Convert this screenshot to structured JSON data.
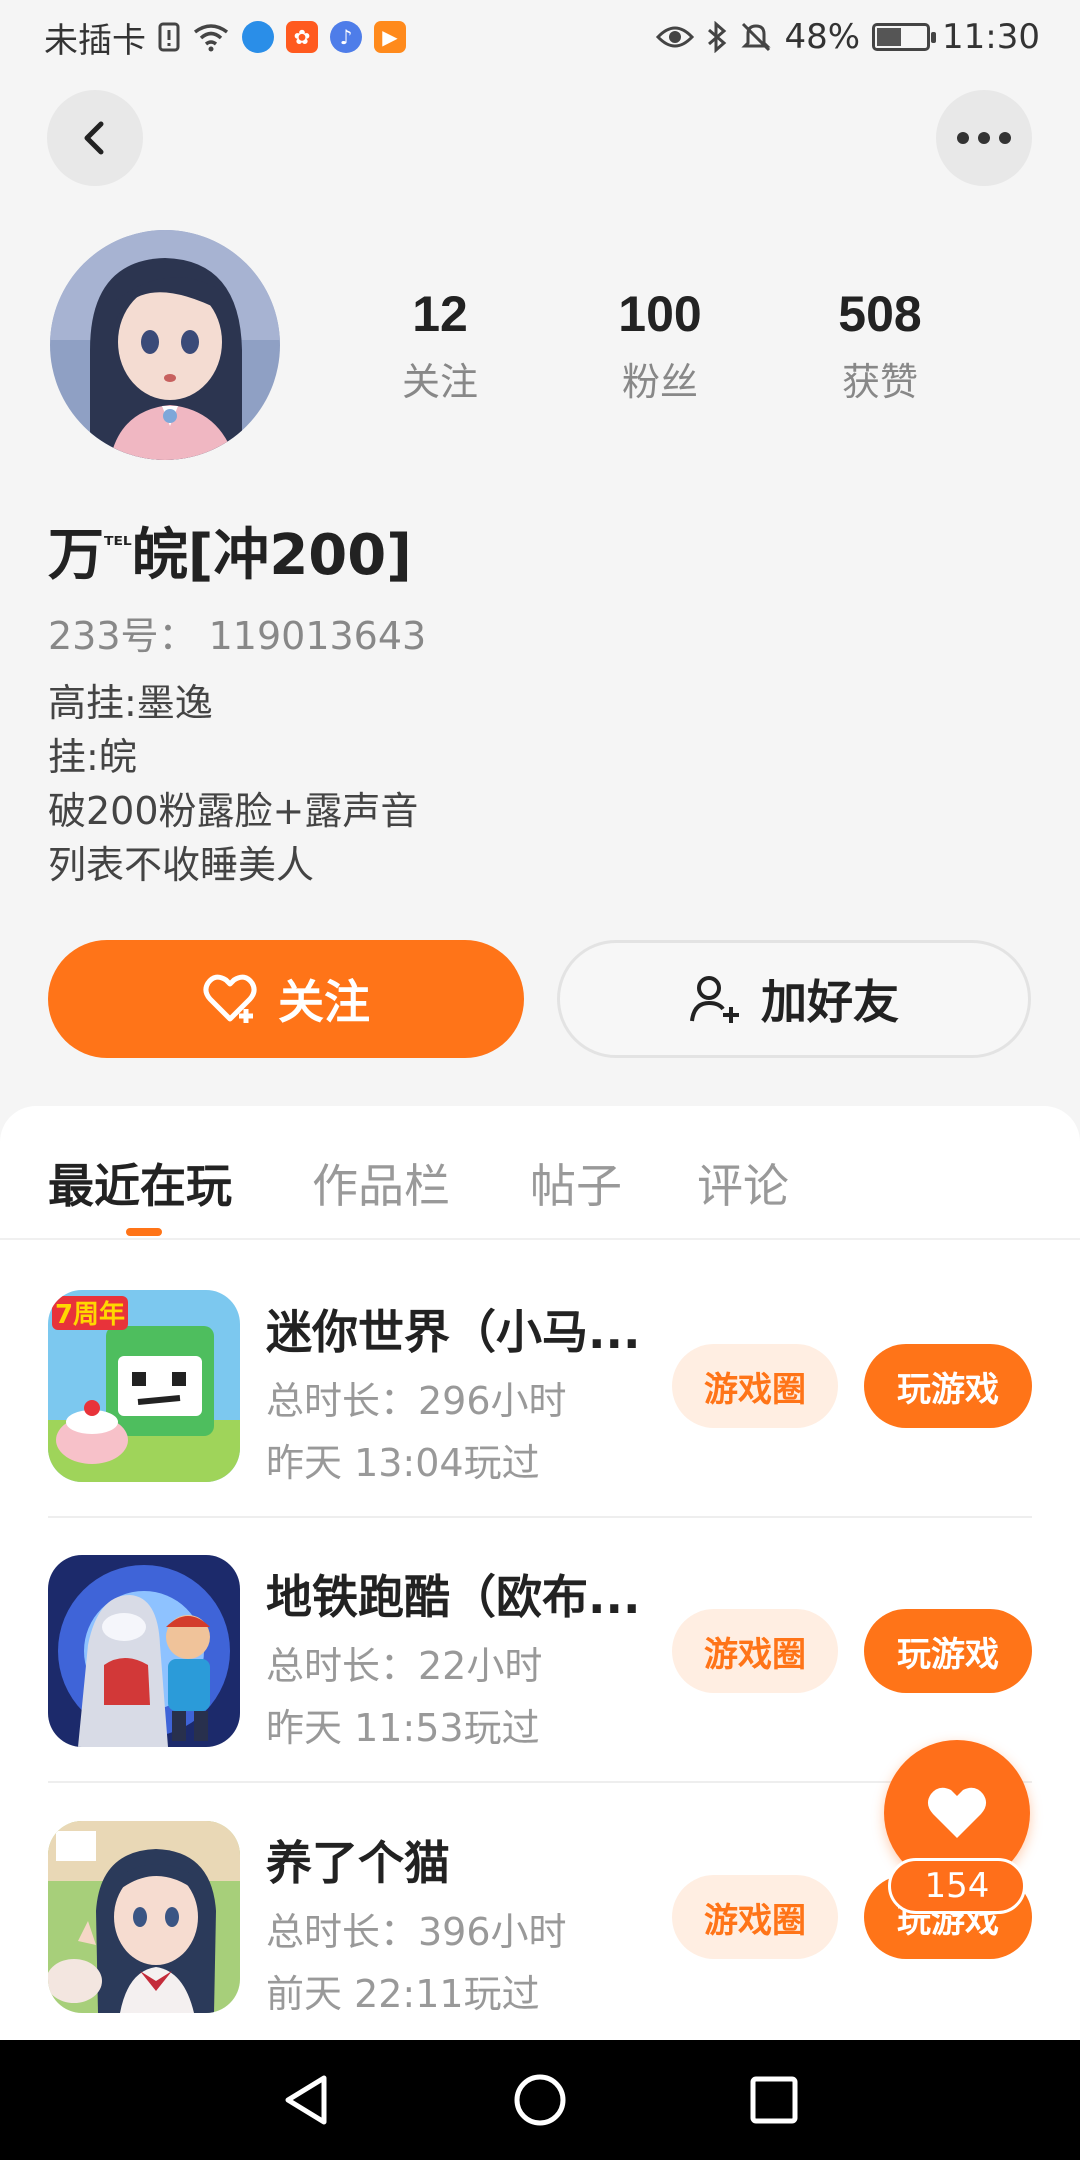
{
  "status_bar": {
    "carrier": "未插卡",
    "battery_percent": "48%",
    "battery_level": 0.48,
    "time": "11:30",
    "icons": [
      "sim-alert-icon",
      "wifi-icon",
      "browser-icon",
      "app-icon",
      "music-icon",
      "video-icon",
      "eye-icon",
      "bluetooth-icon",
      "mute-icon",
      "battery-icon"
    ]
  },
  "nav": {
    "back_icon": "chevron-left-icon",
    "more_icon": "more-dots-icon"
  },
  "profile": {
    "stats": [
      {
        "value": "12",
        "label": "关注"
      },
      {
        "value": "100",
        "label": "粉丝"
      },
      {
        "value": "508",
        "label": "获赞"
      }
    ],
    "nickname_main": "万",
    "nickname_sup": "ᵀᴱᴸ",
    "nickname_rest": "皖[冲200]",
    "id_text": "233号： 119013643",
    "bio_lines": [
      "高挂:墨逸",
      "挂:皖",
      "破200粉露脸+露声音",
      "列表不收睡美人"
    ]
  },
  "actions": {
    "follow_label": "关注",
    "add_friend_label": "加好友",
    "accent": "#ff7418"
  },
  "tabs": [
    {
      "label": "最近在玩",
      "active": true
    },
    {
      "label": "作品栏",
      "active": false
    },
    {
      "label": "帖子",
      "active": false
    },
    {
      "label": "评论",
      "active": false
    }
  ],
  "games": [
    {
      "name": "迷你世界（小马...",
      "total": "总时长：296小时",
      "last": "昨天 13:04玩过",
      "circle_label": "游戏圈",
      "play_label": "玩游戏",
      "badge": "7周年"
    },
    {
      "name": "地铁跑酷（欧布...",
      "total": "总时长：22小时",
      "last": "昨天 11:53玩过",
      "circle_label": "游戏圈",
      "play_label": "玩游戏"
    },
    {
      "name": "养了个猫",
      "total": "总时长：396小时",
      "last": "前天 22:11玩过",
      "circle_label": "游戏圈",
      "play_label": "玩游戏"
    }
  ],
  "like_fab": {
    "count": "154",
    "icon": "heart-icon"
  }
}
